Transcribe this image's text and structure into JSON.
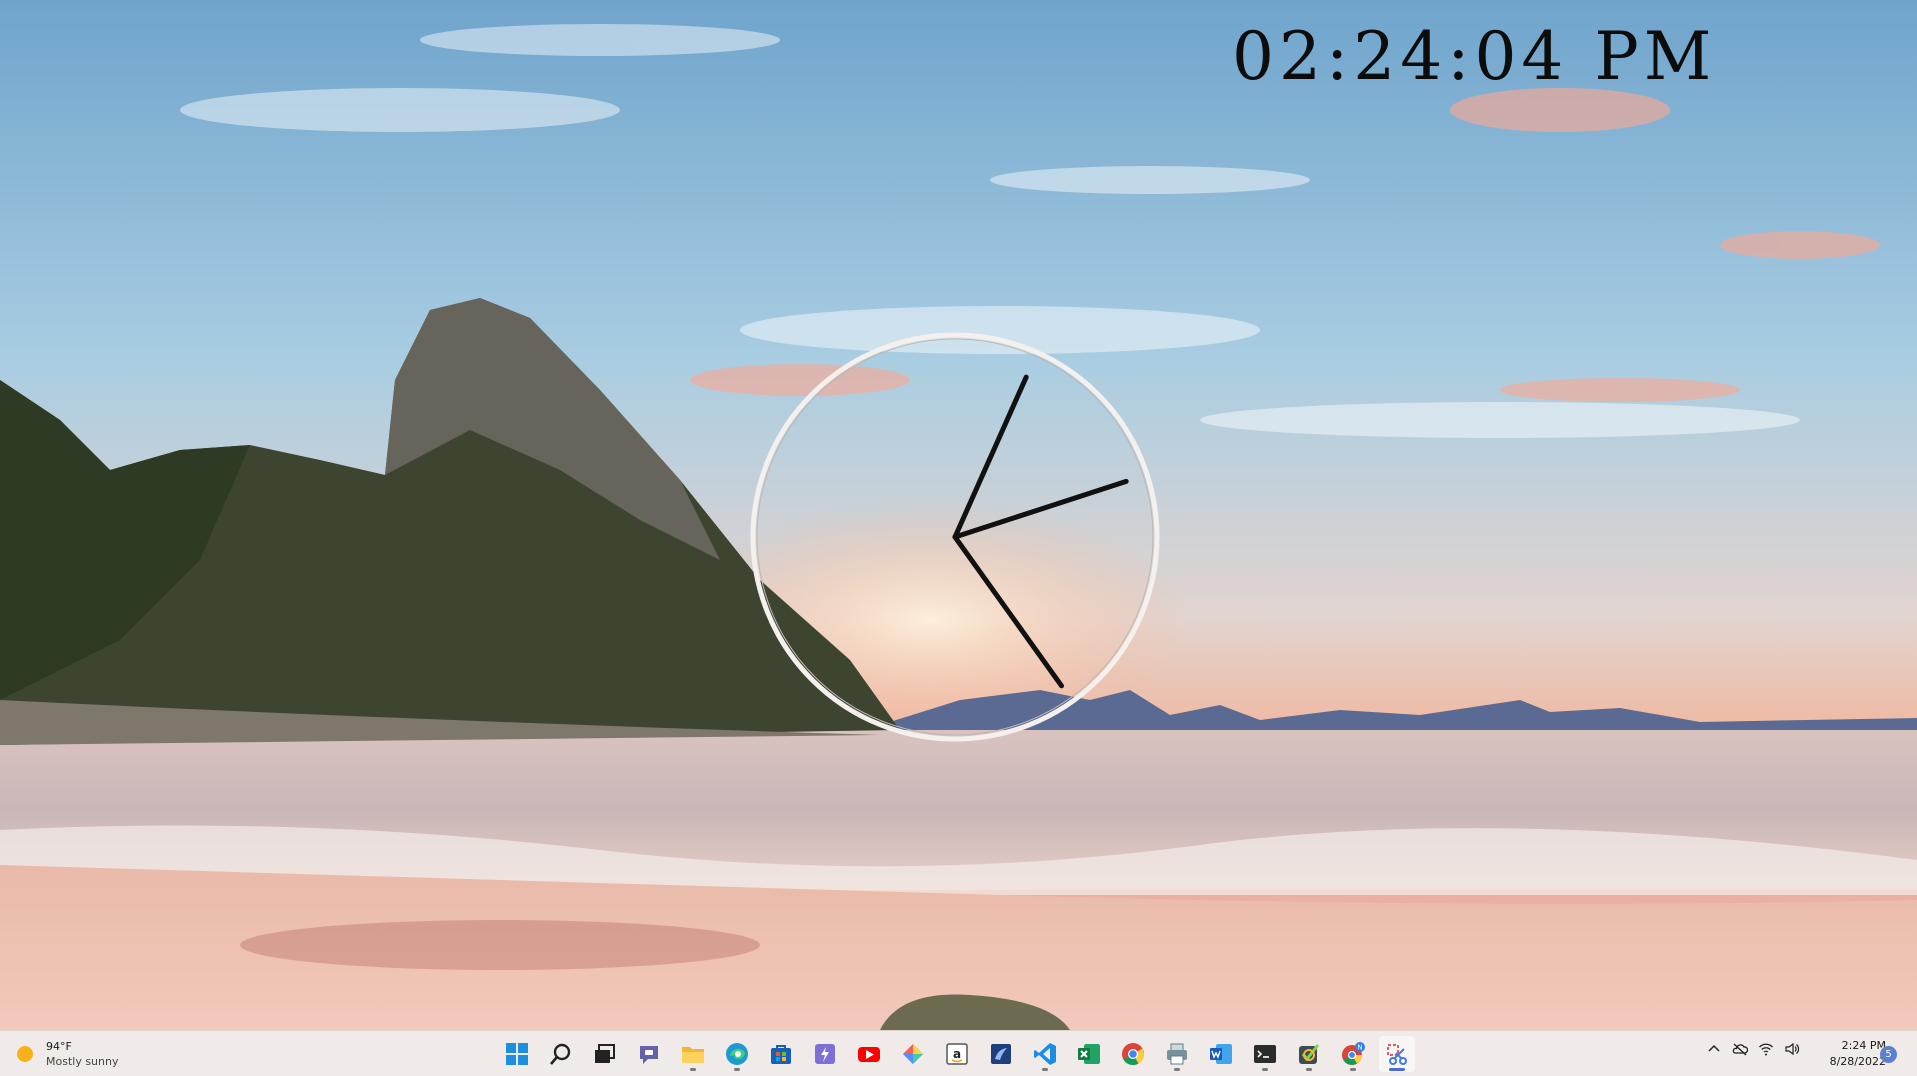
{
  "desktop": {
    "digital_clock_time": "02:24:04 PM",
    "analog_clock": {
      "hour": 2,
      "minute": 24,
      "second": 4
    }
  },
  "taskbar": {
    "weather": {
      "temperature": "94°F",
      "condition": "Mostly sunny"
    },
    "apps": [
      {
        "name": "start",
        "icon": "windows-logo-icon",
        "running": false
      },
      {
        "name": "search",
        "icon": "search-icon",
        "running": false
      },
      {
        "name": "task-view",
        "icon": "task-view-icon",
        "running": false
      },
      {
        "name": "chat",
        "icon": "teams-chat-icon",
        "running": false
      },
      {
        "name": "file-explorer",
        "icon": "folder-icon",
        "running": true
      },
      {
        "name": "edge",
        "icon": "edge-icon",
        "running": true
      },
      {
        "name": "store",
        "icon": "store-icon",
        "running": false
      },
      {
        "name": "power-automate",
        "icon": "power-automate-icon",
        "running": false
      },
      {
        "name": "youtube",
        "icon": "youtube-icon",
        "running": false
      },
      {
        "name": "power-toys",
        "icon": "colorful-diamond-icon",
        "running": false
      },
      {
        "name": "amazon",
        "icon": "amazon-icon",
        "running": false
      },
      {
        "name": "sql-server",
        "icon": "sql-server-icon",
        "running": false
      },
      {
        "name": "vs-code",
        "icon": "vscode-icon",
        "running": true
      },
      {
        "name": "excel",
        "icon": "excel-icon",
        "running": false
      },
      {
        "name": "chrome",
        "icon": "chrome-icon",
        "running": false
      },
      {
        "name": "printer-app",
        "icon": "printer-icon",
        "running": true
      },
      {
        "name": "word",
        "icon": "word-icon",
        "running": false
      },
      {
        "name": "terminal",
        "icon": "terminal-icon",
        "running": true
      },
      {
        "name": "task-app",
        "icon": "checkmark-app-icon",
        "running": true
      },
      {
        "name": "chrome-profile",
        "icon": "chrome-profile-icon",
        "running": true
      },
      {
        "name": "snipping-tool",
        "icon": "snipping-tool-icon",
        "running": true,
        "active": true
      }
    ],
    "tray": {
      "icons": [
        "chevron-up-icon",
        "onedrive-offline-icon",
        "wifi-icon",
        "volume-icon"
      ],
      "time": "2:24 PM",
      "date": "8/28/2022",
      "notification_count": "5"
    }
  }
}
